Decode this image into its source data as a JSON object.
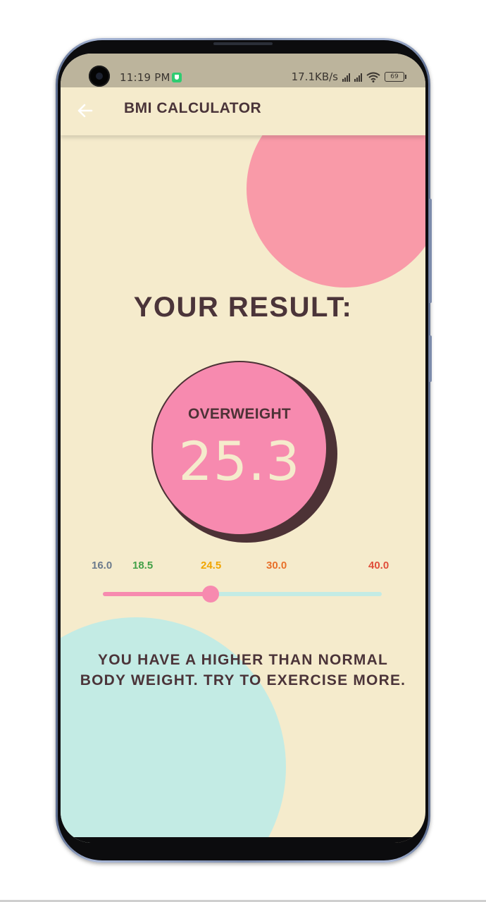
{
  "status_bar": {
    "time": "11:19 PM",
    "network_speed": "17.1KB/s",
    "battery_level": "69"
  },
  "app_bar": {
    "title": "BMI CALCULATOR"
  },
  "result": {
    "heading": "YOUR RESULT:",
    "category": "OVERWEIGHT",
    "bmi_value": "25.3"
  },
  "scale": {
    "ticks": [
      {
        "label": "16.0",
        "value": 16.0,
        "color": "#6b7a8c"
      },
      {
        "label": "18.5",
        "value": 18.5,
        "color": "#43a047"
      },
      {
        "label": "24.5",
        "value": 24.5,
        "color": "#f0a500"
      },
      {
        "label": "30.0",
        "value": 30.0,
        "color": "#e8702a"
      },
      {
        "label": "40.0",
        "value": 40.0,
        "color": "#e04e3a"
      }
    ],
    "min": 16.0,
    "max": 40.0,
    "current": 25.3
  },
  "message": {
    "line1": "YOU HAVE A HIGHER THAN NORMAL",
    "line2": "BODY WEIGHT. TRY TO EXERCISE MORE."
  },
  "colors": {
    "background": "#f5ebcc",
    "accent_pink": "#f78aaf",
    "accent_teal": "#c3ebe4",
    "text_dark": "#4b3439"
  },
  "icons": {
    "back": "arrow-left-icon",
    "camera": "camera-icon",
    "wifi": "wifi-icon",
    "battery": "battery-icon"
  }
}
